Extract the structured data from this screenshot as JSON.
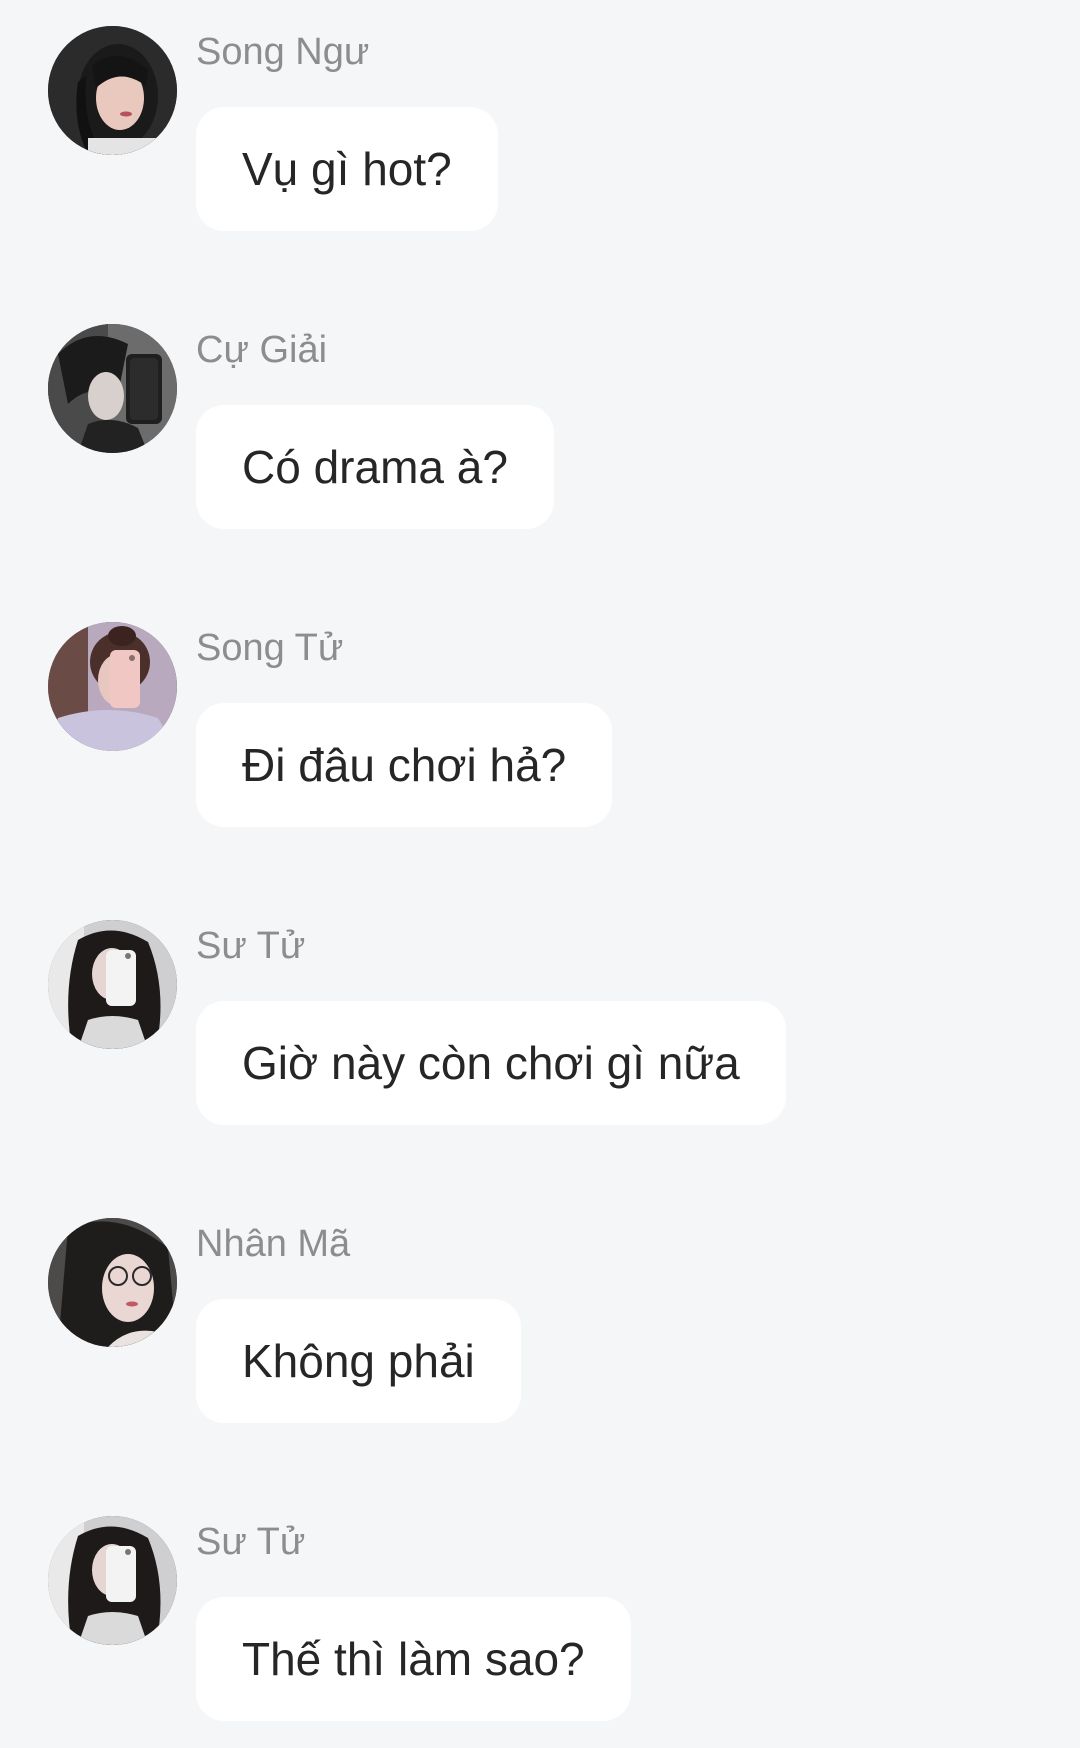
{
  "messages": [
    {
      "sender": "Song Ngư",
      "text": "Vụ gì hot?",
      "avatar": "avatar-dark-hair-girl"
    },
    {
      "sender": "Cự Giải",
      "text": "Có drama à?",
      "avatar": "avatar-mirror-selfie-dark"
    },
    {
      "sender": "Song Tử",
      "text": "Đi đâu chơi hả?",
      "avatar": "avatar-pink-phone-selfie"
    },
    {
      "sender": "Sư Tử",
      "text": "Giờ này còn chơi gì nữa",
      "avatar": "avatar-curly-hair-phone"
    },
    {
      "sender": "Nhân Mã",
      "text": "Không phải",
      "avatar": "avatar-glasses-girl"
    },
    {
      "sender": "Sư Tử",
      "text": "Thế thì làm sao?",
      "avatar": "avatar-curly-hair-phone"
    }
  ],
  "colors": {
    "background": "#f5f6f8",
    "bubble": "#ffffff",
    "sender_text": "#8d8d8d",
    "message_text": "#262626"
  }
}
